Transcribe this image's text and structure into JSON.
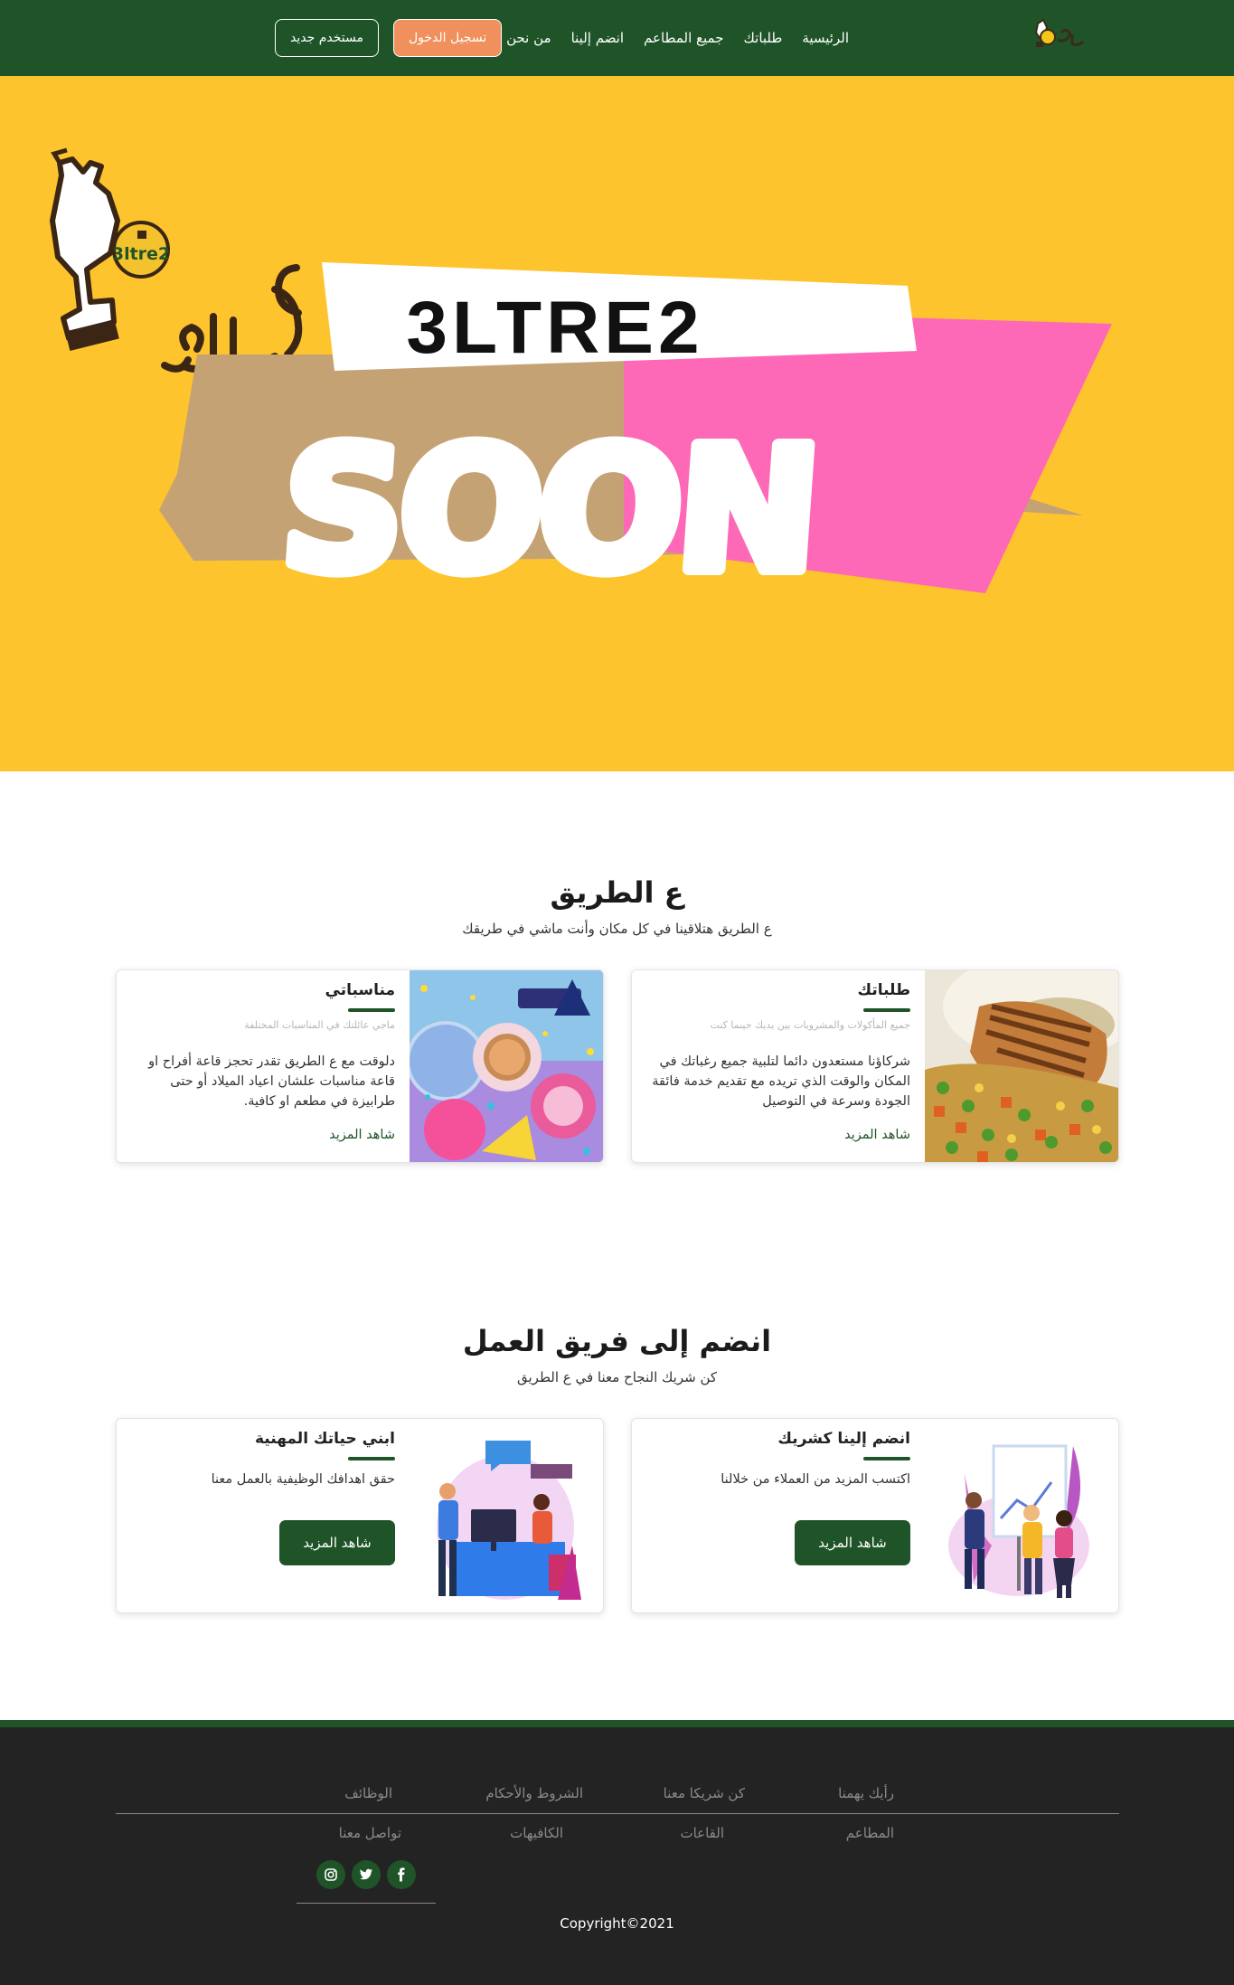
{
  "nav": {
    "links": [
      "الرئيسية",
      "طلباتك",
      "جميع المطاعم",
      "انضم إلينا",
      "من نحن"
    ],
    "login_label": "تسجيل الدخول",
    "register_label": "مستخدم جديد"
  },
  "hero": {
    "brand_text": "3LTRE2",
    "soon_text": "SOON",
    "logo_badge": "3ltre2",
    "logo_arabic": "عالطريق"
  },
  "about": {
    "title": "ع الطريق",
    "subtitle": "ع الطريق هتلاقينا في كل مكان وأنت ماشي في طريقك",
    "cards": [
      {
        "title": "طلباتك",
        "small": "جميع المأكولات والمشروبات بين يديك حينما كنت",
        "text": "شركاؤنا مستعدون دائما لتلبية جميع رغباتك في المكان والوقت الذي تريده مع تقديم خدمة فائقة الجودة وسرعة في التوصيل",
        "link": "شاهد المزيد",
        "image_icon": "grilled-chicken-photo"
      },
      {
        "title": "مناسباتي",
        "small": "ماجي عائلتك في المناسبات المختلفة",
        "text": "دلوقت مع ع الطريق تقدر تحجز قاعة أفراح او قاعة مناسبات علشان اعياد الميلاد أو حتى طرابيزة في مطعم او كافية.",
        "link": "شاهد المزيد",
        "image_icon": "birthday-party-photo"
      }
    ]
  },
  "team": {
    "title": "انضم إلى فريق العمل",
    "subtitle": "كن شريك النجاح معنا في ع الطريق",
    "cards": [
      {
        "title": "انضم إلينا كشريك",
        "text": "اكتسب المزيد من العملاء من خلالنا",
        "button": "شاهد المزيد",
        "image_icon": "partners-illustration"
      },
      {
        "title": "ابني حياتك المهنية",
        "text": "حقق اهدافك الوظيفية بالعمل معنا",
        "button": "شاهد المزيد",
        "image_icon": "career-illustration"
      }
    ]
  },
  "footer": {
    "row1": [
      "رأيك يهمنا",
      "كن شريكا معنا",
      "الشروط والأحكام",
      "الوظائف"
    ],
    "row2": [
      "المطاعم",
      "القاعات",
      "الكافيهات",
      "تواصل معنا"
    ],
    "social": [
      "facebook-icon",
      "twitter-icon",
      "instagram-icon"
    ],
    "copyright": "Copyright©2021"
  },
  "colors": {
    "primary_green": "#1f5428",
    "hero_yellow": "#fec42d",
    "login_orange": "#f0915d",
    "footer_dark": "#232323"
  }
}
